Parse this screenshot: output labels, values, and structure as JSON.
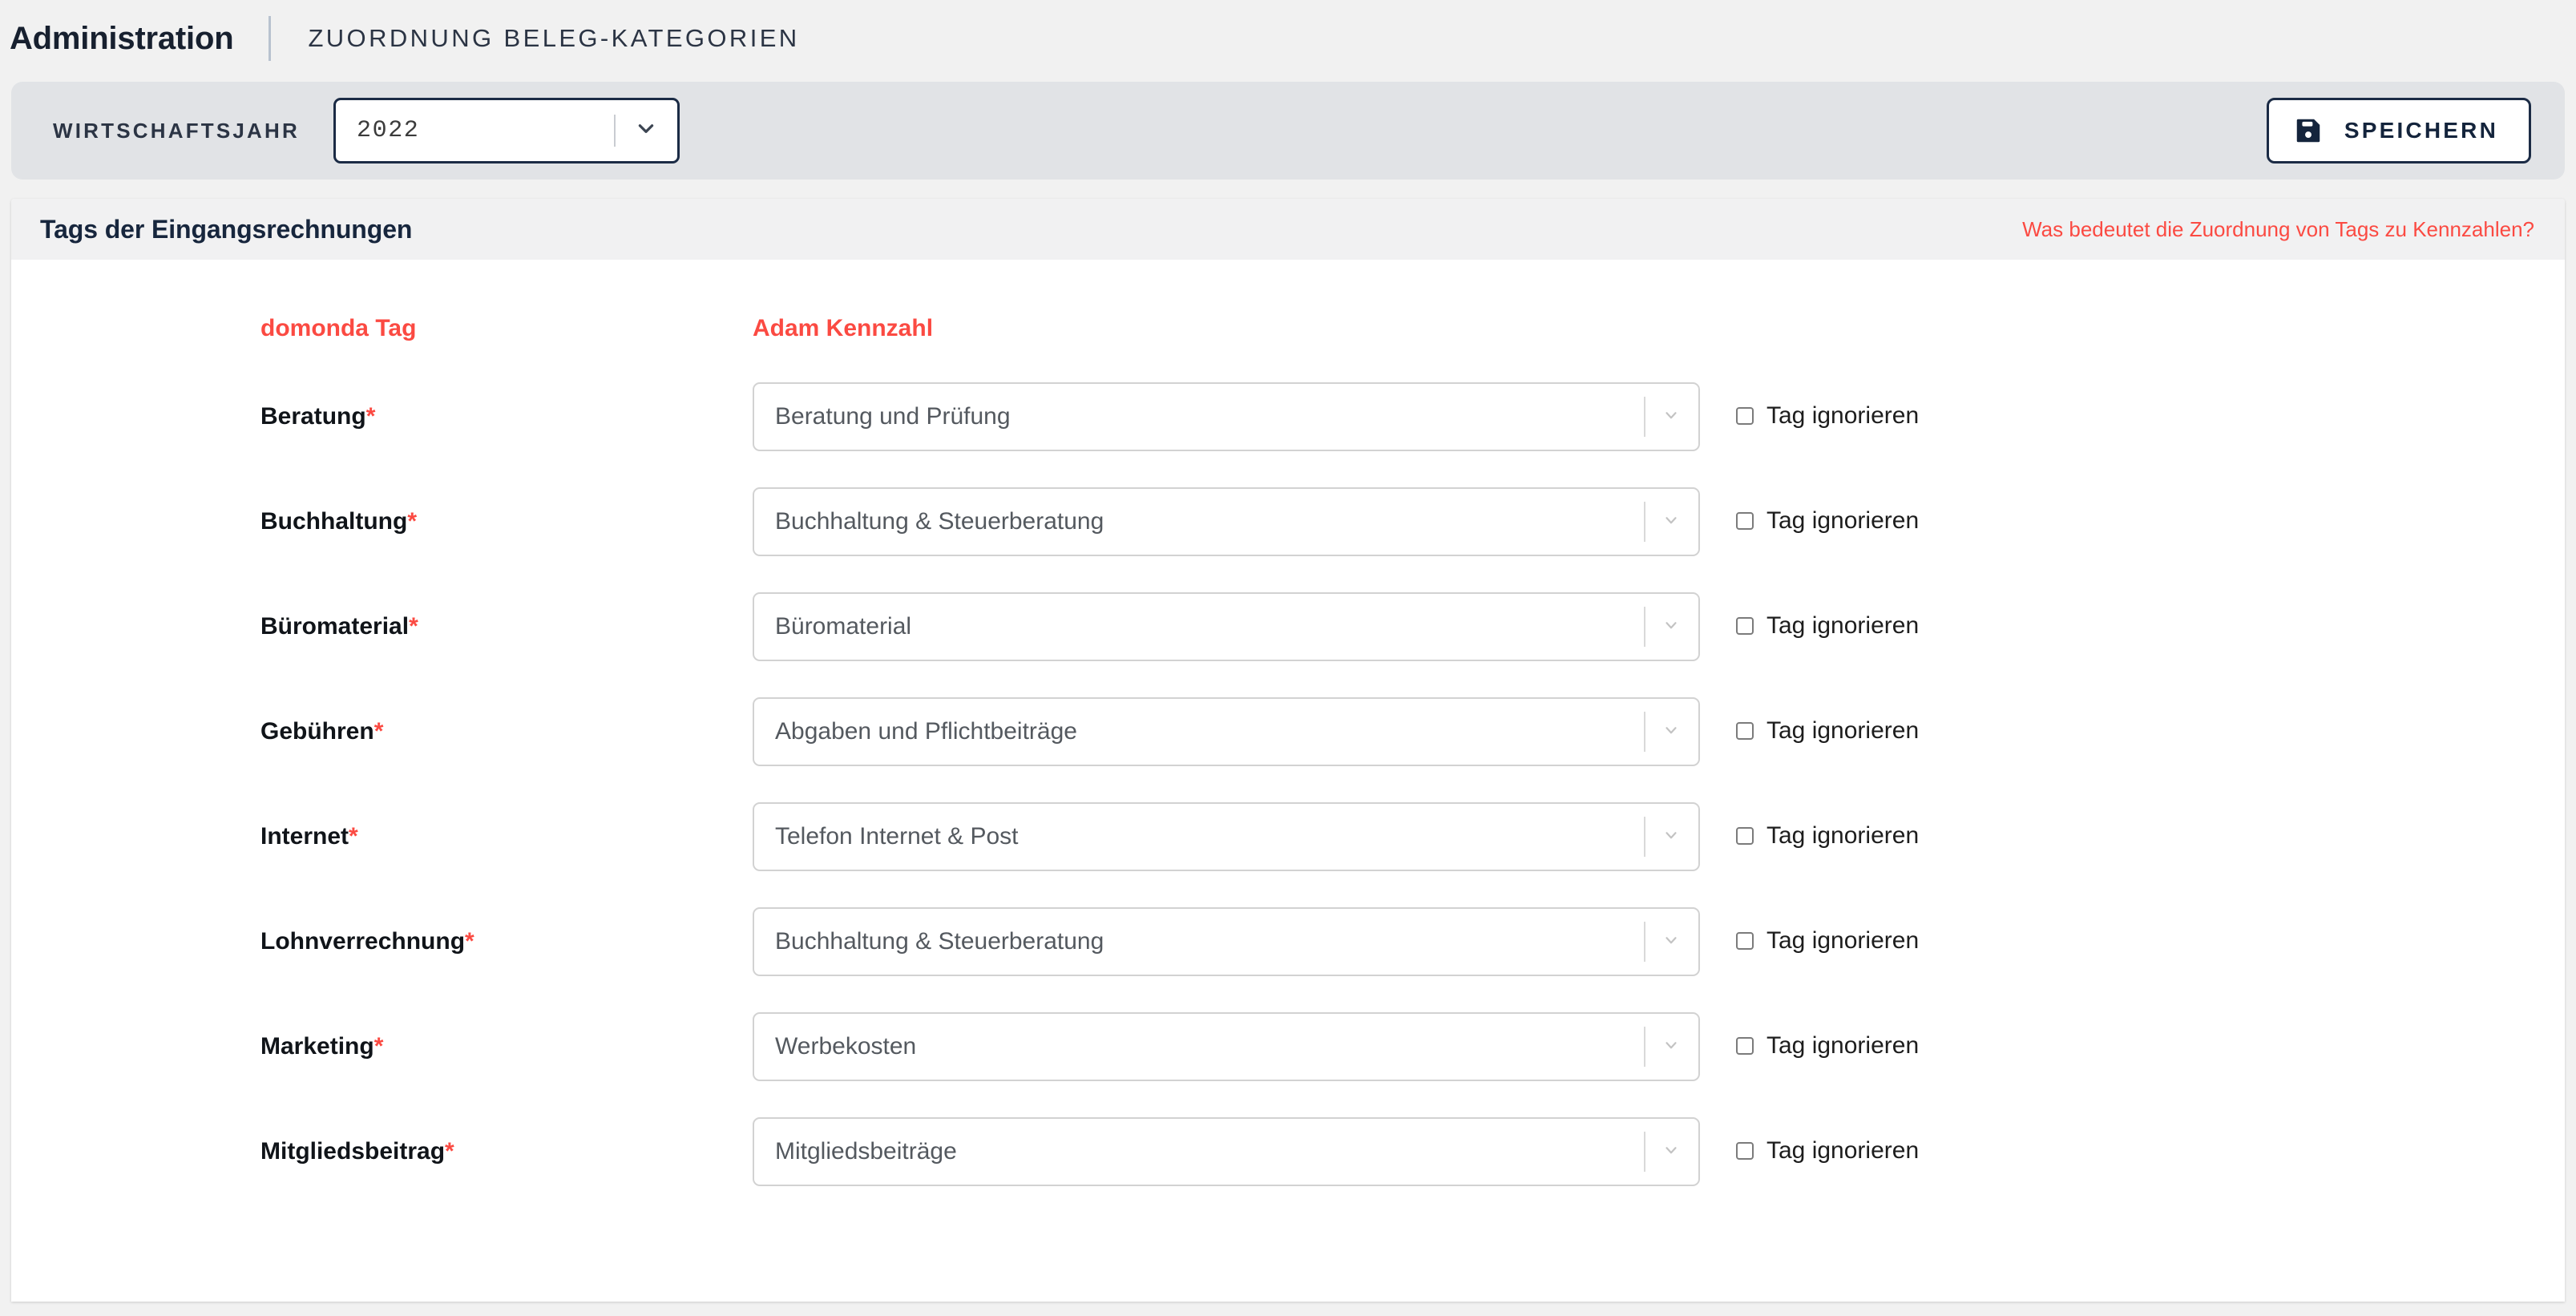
{
  "topbar": {
    "title": "Administration",
    "subtitle": "ZUORDNUNG BELEG-KATEGORIEN"
  },
  "toolbar": {
    "year_label": "WIRTSCHAFTSJAHR",
    "year_value": "2022",
    "save_label": "SPEICHERN",
    "save_icon": "floppy-disk-icon",
    "chevron_icon": "chevron-down-icon"
  },
  "card": {
    "header_title": "Tags der Eingangsrechnungen",
    "help_link": "Was bedeutet die Zuordnung von Tags zu Kennzahlen?"
  },
  "columns": {
    "tag": "domonda Tag",
    "kennzahl": "Adam Kennzahl"
  },
  "ignore_label": "Tag ignorieren",
  "required_marker": "*",
  "colors": {
    "accent_red": "#fb4a42",
    "navy": "#1b2b45",
    "page_bg": "#f1f1f1",
    "toolbar_bg": "#e1e3e6",
    "card_header_bg": "#f1f1f2"
  },
  "rows": [
    {
      "tag": "Beratung",
      "kennzahl": "Beratung und Prüfung",
      "ignore": false
    },
    {
      "tag": "Buchhaltung",
      "kennzahl": "Buchhaltung & Steuerberatung",
      "ignore": false
    },
    {
      "tag": "Büromaterial",
      "kennzahl": "Büromaterial",
      "ignore": false
    },
    {
      "tag": "Gebühren",
      "kennzahl": "Abgaben und Pflichtbeiträge",
      "ignore": false
    },
    {
      "tag": "Internet",
      "kennzahl": "Telefon Internet & Post",
      "ignore": false
    },
    {
      "tag": "Lohnverrechnung",
      "kennzahl": "Buchhaltung & Steuerberatung",
      "ignore": false
    },
    {
      "tag": "Marketing",
      "kennzahl": "Werbekosten",
      "ignore": false
    },
    {
      "tag": "Mitgliedsbeitrag",
      "kennzahl": "Mitgliedsbeiträge",
      "ignore": false
    }
  ]
}
